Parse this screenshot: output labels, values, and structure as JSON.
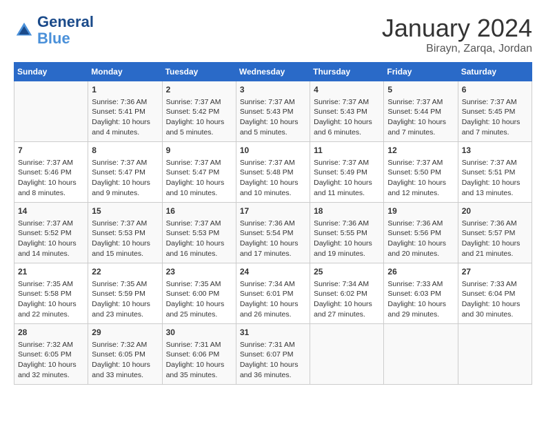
{
  "header": {
    "logo_line1": "General",
    "logo_line2": "Blue",
    "month": "January 2024",
    "location": "Birayn, Zarqa, Jordan"
  },
  "days_of_week": [
    "Sunday",
    "Monday",
    "Tuesday",
    "Wednesday",
    "Thursday",
    "Friday",
    "Saturday"
  ],
  "weeks": [
    [
      {
        "day": "",
        "info": ""
      },
      {
        "day": "1",
        "info": "Sunrise: 7:36 AM\nSunset: 5:41 PM\nDaylight: 10 hours\nand 4 minutes."
      },
      {
        "day": "2",
        "info": "Sunrise: 7:37 AM\nSunset: 5:42 PM\nDaylight: 10 hours\nand 5 minutes."
      },
      {
        "day": "3",
        "info": "Sunrise: 7:37 AM\nSunset: 5:43 PM\nDaylight: 10 hours\nand 5 minutes."
      },
      {
        "day": "4",
        "info": "Sunrise: 7:37 AM\nSunset: 5:43 PM\nDaylight: 10 hours\nand 6 minutes."
      },
      {
        "day": "5",
        "info": "Sunrise: 7:37 AM\nSunset: 5:44 PM\nDaylight: 10 hours\nand 7 minutes."
      },
      {
        "day": "6",
        "info": "Sunrise: 7:37 AM\nSunset: 5:45 PM\nDaylight: 10 hours\nand 7 minutes."
      }
    ],
    [
      {
        "day": "7",
        "info": "Sunrise: 7:37 AM\nSunset: 5:46 PM\nDaylight: 10 hours\nand 8 minutes."
      },
      {
        "day": "8",
        "info": "Sunrise: 7:37 AM\nSunset: 5:47 PM\nDaylight: 10 hours\nand 9 minutes."
      },
      {
        "day": "9",
        "info": "Sunrise: 7:37 AM\nSunset: 5:47 PM\nDaylight: 10 hours\nand 10 minutes."
      },
      {
        "day": "10",
        "info": "Sunrise: 7:37 AM\nSunset: 5:48 PM\nDaylight: 10 hours\nand 10 minutes."
      },
      {
        "day": "11",
        "info": "Sunrise: 7:37 AM\nSunset: 5:49 PM\nDaylight: 10 hours\nand 11 minutes."
      },
      {
        "day": "12",
        "info": "Sunrise: 7:37 AM\nSunset: 5:50 PM\nDaylight: 10 hours\nand 12 minutes."
      },
      {
        "day": "13",
        "info": "Sunrise: 7:37 AM\nSunset: 5:51 PM\nDaylight: 10 hours\nand 13 minutes."
      }
    ],
    [
      {
        "day": "14",
        "info": "Sunrise: 7:37 AM\nSunset: 5:52 PM\nDaylight: 10 hours\nand 14 minutes."
      },
      {
        "day": "15",
        "info": "Sunrise: 7:37 AM\nSunset: 5:53 PM\nDaylight: 10 hours\nand 15 minutes."
      },
      {
        "day": "16",
        "info": "Sunrise: 7:37 AM\nSunset: 5:53 PM\nDaylight: 10 hours\nand 16 minutes."
      },
      {
        "day": "17",
        "info": "Sunrise: 7:36 AM\nSunset: 5:54 PM\nDaylight: 10 hours\nand 17 minutes."
      },
      {
        "day": "18",
        "info": "Sunrise: 7:36 AM\nSunset: 5:55 PM\nDaylight: 10 hours\nand 19 minutes."
      },
      {
        "day": "19",
        "info": "Sunrise: 7:36 AM\nSunset: 5:56 PM\nDaylight: 10 hours\nand 20 minutes."
      },
      {
        "day": "20",
        "info": "Sunrise: 7:36 AM\nSunset: 5:57 PM\nDaylight: 10 hours\nand 21 minutes."
      }
    ],
    [
      {
        "day": "21",
        "info": "Sunrise: 7:35 AM\nSunset: 5:58 PM\nDaylight: 10 hours\nand 22 minutes."
      },
      {
        "day": "22",
        "info": "Sunrise: 7:35 AM\nSunset: 5:59 PM\nDaylight: 10 hours\nand 23 minutes."
      },
      {
        "day": "23",
        "info": "Sunrise: 7:35 AM\nSunset: 6:00 PM\nDaylight: 10 hours\nand 25 minutes."
      },
      {
        "day": "24",
        "info": "Sunrise: 7:34 AM\nSunset: 6:01 PM\nDaylight: 10 hours\nand 26 minutes."
      },
      {
        "day": "25",
        "info": "Sunrise: 7:34 AM\nSunset: 6:02 PM\nDaylight: 10 hours\nand 27 minutes."
      },
      {
        "day": "26",
        "info": "Sunrise: 7:33 AM\nSunset: 6:03 PM\nDaylight: 10 hours\nand 29 minutes."
      },
      {
        "day": "27",
        "info": "Sunrise: 7:33 AM\nSunset: 6:04 PM\nDaylight: 10 hours\nand 30 minutes."
      }
    ],
    [
      {
        "day": "28",
        "info": "Sunrise: 7:32 AM\nSunset: 6:05 PM\nDaylight: 10 hours\nand 32 minutes."
      },
      {
        "day": "29",
        "info": "Sunrise: 7:32 AM\nSunset: 6:05 PM\nDaylight: 10 hours\nand 33 minutes."
      },
      {
        "day": "30",
        "info": "Sunrise: 7:31 AM\nSunset: 6:06 PM\nDaylight: 10 hours\nand 35 minutes."
      },
      {
        "day": "31",
        "info": "Sunrise: 7:31 AM\nSunset: 6:07 PM\nDaylight: 10 hours\nand 36 minutes."
      },
      {
        "day": "",
        "info": ""
      },
      {
        "day": "",
        "info": ""
      },
      {
        "day": "",
        "info": ""
      }
    ]
  ]
}
